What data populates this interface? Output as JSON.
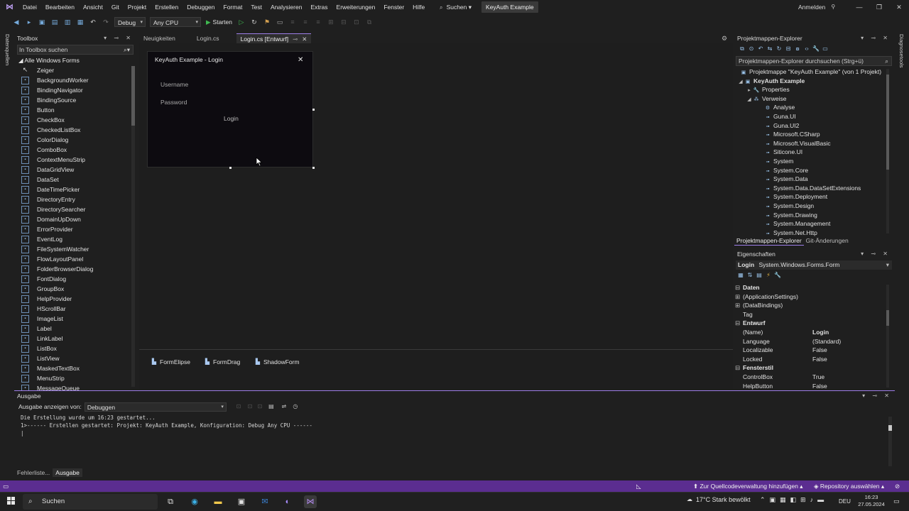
{
  "menu": {
    "items": [
      "Datei",
      "Bearbeiten",
      "Ansicht",
      "Git",
      "Projekt",
      "Erstellen",
      "Debuggen",
      "Format",
      "Test",
      "Analysieren",
      "Extras",
      "Erweiterungen",
      "Fenster",
      "Hilfe"
    ],
    "search": "Suchen ▾",
    "solution_name": "KeyAuth Example",
    "sign_in": "Anmelden"
  },
  "toolbar": {
    "config": "Debug",
    "platform": "Any CPU",
    "start": "Starten"
  },
  "rails": {
    "left": "Datenquellen",
    "right": "Diagnosetools"
  },
  "toolbox": {
    "title": "Toolbox",
    "search_placeholder": "In Toolbox suchen",
    "group": "◢ Alle Windows Forms",
    "items": [
      "Zeiger",
      "BackgroundWorker",
      "BindingNavigator",
      "BindingSource",
      "Button",
      "CheckBox",
      "CheckedListBox",
      "ColorDialog",
      "ComboBox",
      "ContextMenuStrip",
      "DataGridView",
      "DataSet",
      "DateTimePicker",
      "DirectoryEntry",
      "DirectorySearcher",
      "DomainUpDown",
      "ErrorProvider",
      "EventLog",
      "FileSystemWatcher",
      "FlowLayoutPanel",
      "FolderBrowserDialog",
      "FontDialog",
      "GroupBox",
      "HelpProvider",
      "HScrollBar",
      "ImageList",
      "Label",
      "LinkLabel",
      "ListBox",
      "ListView",
      "MaskedTextBox",
      "MenuStrip",
      "MessageQueue"
    ]
  },
  "tabs": {
    "items": [
      "Neuigkeiten",
      "Login.cs",
      "Login.cs [Entwurf]"
    ],
    "active_pin": "⊸",
    "active_close": "✕"
  },
  "form": {
    "title": "KeyAuth Example - Login",
    "close": "✕",
    "username_placeholder": "Username",
    "password_placeholder": "Password",
    "login": "Login"
  },
  "tray": {
    "items": [
      "FormElipse",
      "FormDrag",
      "ShadowForm"
    ]
  },
  "solution_explorer": {
    "title": "Projektmappen-Explorer",
    "search_placeholder": "Projektmappen-Explorer durchsuchen (Strg+ü)",
    "solution": "Projektmappe \"KeyAuth Example\" (von 1 Projekt)",
    "project": "KeyAuth Example",
    "properties": "Properties",
    "references": "Verweise",
    "analyzer": "Analyse",
    "refs": [
      "Guna.UI",
      "Guna.UI2",
      "Microsoft.CSharp",
      "Microsoft.VisualBasic",
      "Siticone.UI",
      "System",
      "System.Core",
      "System.Data",
      "System.Data.DataSetExtensions",
      "System.Deployment",
      "System.Design",
      "System.Drawing",
      "System.Management",
      "System.Net.Http"
    ],
    "tabs": [
      "Projektmappen-Explorer",
      "Git-Änderungen"
    ]
  },
  "properties": {
    "title": "Eigenschaften",
    "object_name": "Login",
    "object_type": "System.Windows.Forms.Form",
    "categories": [
      {
        "name": "Daten",
        "rows": [
          {
            "name": "(ApplicationSettings)",
            "value": "",
            "expand": true
          },
          {
            "name": "(DataBindings)",
            "value": "",
            "expand": true
          },
          {
            "name": "Tag",
            "value": ""
          }
        ]
      },
      {
        "name": "Entwurf",
        "rows": [
          {
            "name": "(Name)",
            "value": "Login",
            "bold": true
          },
          {
            "name": "Language",
            "value": "(Standard)"
          },
          {
            "name": "Localizable",
            "value": "False"
          },
          {
            "name": "Locked",
            "value": "False"
          }
        ]
      },
      {
        "name": "Fensterstil",
        "rows": [
          {
            "name": "ControlBox",
            "value": "True"
          },
          {
            "name": "HelpButton",
            "value": "False"
          }
        ]
      }
    ]
  },
  "output": {
    "title": "Ausgabe",
    "source_label": "Ausgabe anzeigen von:",
    "source": "Debuggen",
    "lines": [
      "Die Erstellung wurde um 16:23 gestartet...",
      "1>------ Erstellen gestartet: Projekt: KeyAuth Example, Konfiguration: Debug Any CPU ------",
      "|"
    ]
  },
  "bottom_tabs": [
    "Fehlerliste...",
    "Ausgabe"
  ],
  "status": {
    "source_control": "⬆ Zur Quellcodeverwaltung hinzufügen ▴",
    "repository": "◈ Repository auswählen ▴"
  },
  "taskbar": {
    "search": "Suchen",
    "weather": "17°C  Stark bewölkt",
    "lang": "DEU",
    "time": "16:23",
    "date": "27.05.2024"
  },
  "colors": {
    "accent": "#9d7ee8",
    "statusbar": "#5b2d90",
    "background": "#1f1f1f"
  }
}
